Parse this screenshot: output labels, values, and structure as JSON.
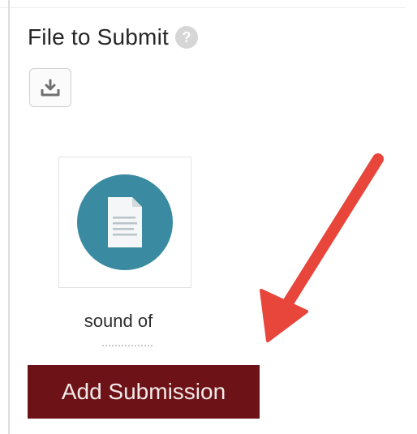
{
  "section": {
    "title": "File to Submit",
    "help_icon_glyph": "?",
    "upload_icon": "upload-tray-icon"
  },
  "file": {
    "name": "sound of",
    "icon": "document-icon",
    "icon_bg_color": "#3a8aa1"
  },
  "actions": {
    "add_submission_label": "Add Submission",
    "add_submission_color": "#6d1217"
  },
  "annotation": {
    "arrow_color": "#e8453b"
  }
}
